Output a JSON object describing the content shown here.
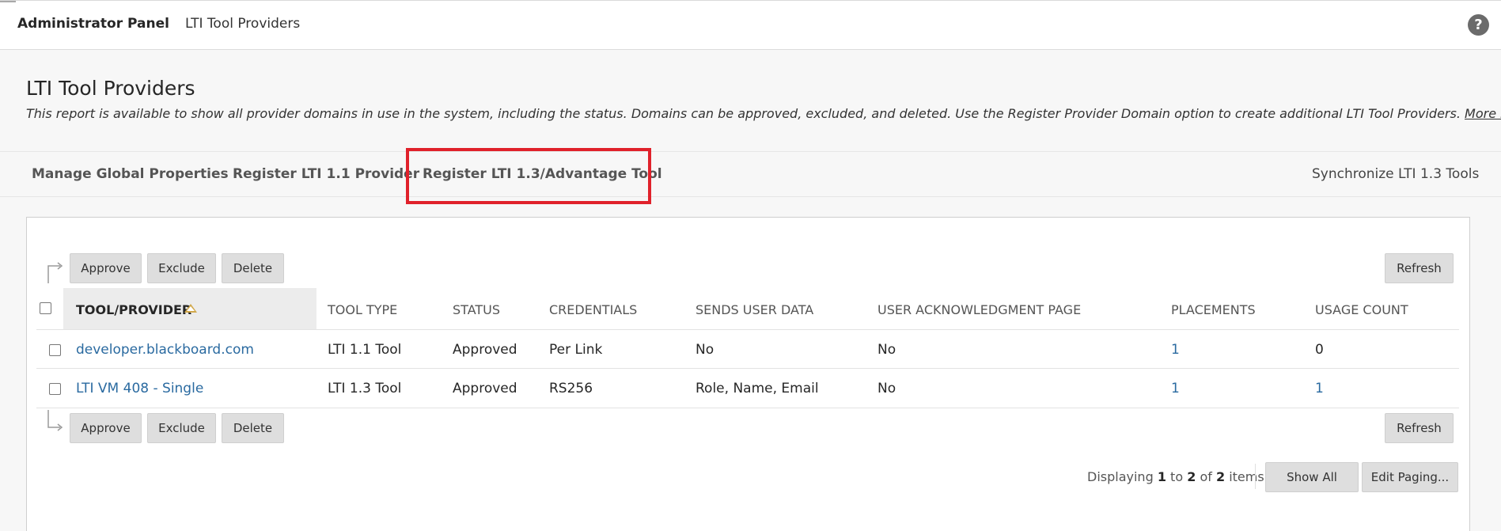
{
  "header": {
    "admin_label": "Administrator Panel",
    "page_label": "LTI Tool Providers",
    "help_glyph": "?"
  },
  "page": {
    "title": "LTI Tool Providers",
    "description": "This report is available to show all provider domains in use in the system, including the status. Domains can be approved, excluded, and deleted. Use the Register Provider Domain option to create additional LTI Tool Providers.",
    "more_help": "More Help"
  },
  "actions": {
    "manage_global": "Manage Global Properties",
    "register_11": "Register LTI 1.1 Provider",
    "register_13": "Register LTI 1.3/Advantage Tool",
    "synchronize": "Synchronize LTI 1.3 Tools"
  },
  "toolbar": {
    "approve": "Approve",
    "exclude": "Exclude",
    "delete": "Delete",
    "refresh": "Refresh"
  },
  "table": {
    "columns": {
      "tool_provider": "TOOL/PROVIDER",
      "tool_type": "TOOL TYPE",
      "status": "STATUS",
      "credentials": "CREDENTIALS",
      "sends_user_data": "SENDS USER DATA",
      "user_ack_page": "USER ACKNOWLEDGMENT PAGE",
      "placements": "PLACEMENTS",
      "usage_count": "USAGE COUNT"
    },
    "rows": [
      {
        "tool_provider": "developer.blackboard.com",
        "tool_type": "LTI 1.1 Tool",
        "status": "Approved",
        "credentials": "Per Link",
        "sends_user_data": "No",
        "user_ack_page": "No",
        "placements": "1",
        "usage_count": "0"
      },
      {
        "tool_provider": "LTI VM 408 - Single",
        "tool_type": "LTI 1.3 Tool",
        "status": "Approved",
        "credentials": "RS256",
        "sends_user_data": "Role, Name, Email",
        "user_ack_page": "No",
        "placements": "1",
        "usage_count": "1"
      }
    ]
  },
  "paging": {
    "prefix": "Displaying",
    "from": "1",
    "to_word": "to",
    "to": "2",
    "of_word": "of",
    "total": "2",
    "suffix": "items",
    "show_all": "Show All",
    "edit_paging": "Edit Paging..."
  },
  "colors": {
    "highlight": "#e0212b",
    "link": "#2a6aa0",
    "sort_icon": "#d1a84b"
  },
  "icons": {
    "help": "help-circle-icon",
    "sort": "sort-ascending-icon",
    "action_arrow": "bent-arrow-icon"
  }
}
